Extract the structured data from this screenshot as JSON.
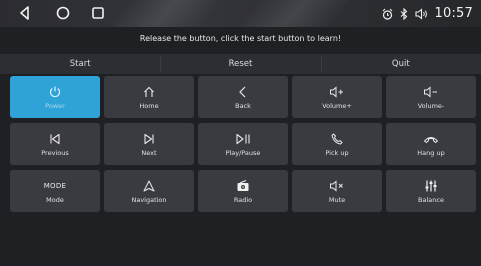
{
  "status_bar": {
    "time": "10:57",
    "icons": [
      "back-triangle-icon",
      "home-circle-icon",
      "recents-square-icon",
      "alarm-icon",
      "bluetooth-icon",
      "volume-icon"
    ]
  },
  "instruction": "Release the button, click the start button to learn!",
  "actions": {
    "start": "Start",
    "reset": "Reset",
    "quit": "Quit"
  },
  "keys": [
    {
      "label": "Power",
      "icon": "power-icon",
      "active": true
    },
    {
      "label": "Home",
      "icon": "home-icon"
    },
    {
      "label": "Back",
      "icon": "back-icon"
    },
    {
      "label": "Volume+",
      "icon": "volume-up-icon"
    },
    {
      "label": "Volume-",
      "icon": "volume-down-icon"
    },
    {
      "label": "Previous",
      "icon": "previous-icon"
    },
    {
      "label": "Next",
      "icon": "next-icon"
    },
    {
      "label": "Play/Pause",
      "icon": "play-pause-icon"
    },
    {
      "label": "Pick up",
      "icon": "pick-up-icon"
    },
    {
      "label": "Hang up",
      "icon": "hang-up-icon"
    },
    {
      "label": "Mode",
      "icon_text": "MODE",
      "icon": "mode-icon"
    },
    {
      "label": "Navigation",
      "icon": "navigation-icon"
    },
    {
      "label": "Radio",
      "icon": "radio-icon"
    },
    {
      "label": "Mute",
      "icon": "mute-icon"
    },
    {
      "label": "Balance",
      "icon": "balance-icon"
    }
  ],
  "colors": {
    "active_key": "#2fa3d8",
    "key_bg": "#3a3b40",
    "background": "#1f2024"
  }
}
